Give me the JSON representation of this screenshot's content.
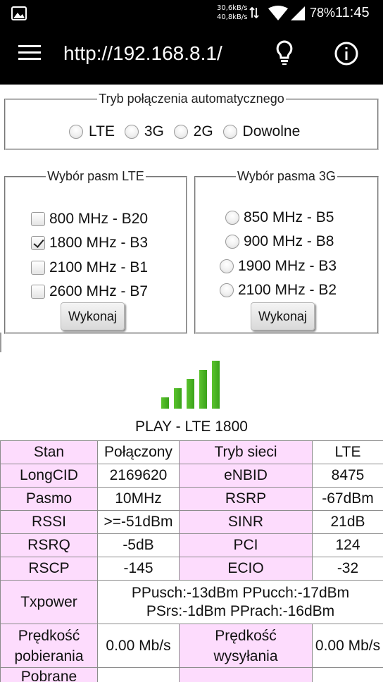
{
  "status_bar": {
    "speed_up": "30,6kB/s",
    "speed_down": "40,8kB/s",
    "battery": "78%",
    "time": "11:45",
    "icons": [
      "image-icon",
      "data-arrows-icon",
      "wifi-icon",
      "cell-signal-icon"
    ]
  },
  "app_bar": {
    "url": "http://192.168.8.1/",
    "icons": [
      "menu-icon",
      "lightbulb-icon",
      "info-icon"
    ]
  },
  "mode": {
    "legend": "Tryb połączenia automatycznego",
    "options": [
      "LTE",
      "3G",
      "2G",
      "Dowolne"
    ]
  },
  "lte": {
    "legend": "Wybór pasm LTE",
    "bands": [
      {
        "label": "800 MHz - B20",
        "checked": false
      },
      {
        "label": "1800 MHz - B3",
        "checked": true
      },
      {
        "label": "2100 MHz - B1",
        "checked": false
      },
      {
        "label": "2600 MHz - B7",
        "checked": false
      }
    ],
    "button": "Wykonaj"
  },
  "umts": {
    "legend": "Wybór pasma 3G",
    "bands": [
      {
        "label": "850 MHz - B5"
      },
      {
        "label": "900 MHz - B8"
      },
      {
        "label": "1900 MHz - B3"
      },
      {
        "label": "2100 MHz - B2"
      }
    ],
    "button": "Wykonaj"
  },
  "signal": {
    "level": 5,
    "max": 5,
    "color": "#3aa31a"
  },
  "network": "PLAY - LTE 1800",
  "table": {
    "rows": [
      [
        "Stan",
        "Połączony",
        "Tryb sieci",
        "LTE"
      ],
      [
        "LongCID",
        "2169620",
        "eNBID",
        "8475"
      ],
      [
        "Pasmo",
        "10MHz",
        "RSRP",
        "-67dBm"
      ],
      [
        "RSSI",
        ">=-51dBm",
        "SINR",
        "21dB"
      ],
      [
        "RSRQ",
        "-5dB",
        "PCI",
        "124"
      ],
      [
        "RSCP",
        "-145",
        "ECIO",
        "-32"
      ]
    ],
    "txpower": {
      "label": "Txpower",
      "line1": "PPusch:-13dBm PPucch:-17dBm",
      "line2": "PSrs:-1dBm PPrach:-16dBm"
    },
    "speed": {
      "down_label": "Prędkość pobierania",
      "down_value": "0.00 Mb/s",
      "up_label": "Prędkość wysyłania",
      "up_value": "0.00 Mb/s"
    },
    "partial_label": "Pobrane"
  },
  "colors": {
    "label_cell": "#fddcfd",
    "bar_dark": "#000000"
  }
}
